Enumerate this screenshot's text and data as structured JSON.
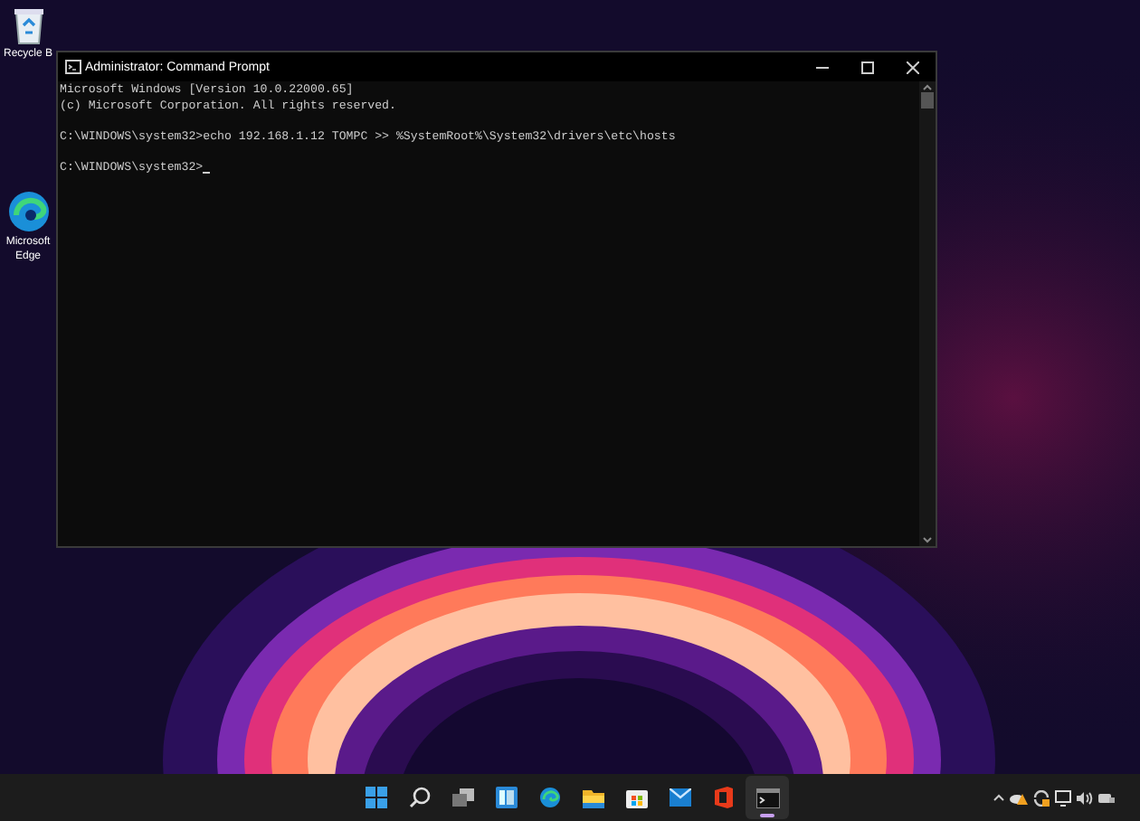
{
  "desktop_icons": [
    {
      "kind": "recycle",
      "label": "Recycle B"
    },
    {
      "kind": "edge",
      "label": "Microsoft Edge"
    }
  ],
  "window": {
    "title": "Administrator: Command Prompt"
  },
  "console": {
    "lines": [
      {
        "text": "Microsoft Windows [Version 10.0.22000.65]",
        "blank_before": false,
        "cursor": false
      },
      {
        "text": "(c) Microsoft Corporation. All rights reserved.",
        "blank_before": false,
        "cursor": false
      },
      {
        "text": "C:\\WINDOWS\\system32>echo 192.168.1.12 TOMPC >> %SystemRoot%\\System32\\drivers\\etc\\hosts",
        "blank_before": true,
        "cursor": false
      },
      {
        "text": "C:\\WINDOWS\\system32>",
        "blank_before": true,
        "cursor": true
      }
    ]
  },
  "taskbar": {
    "apps": [
      {
        "kind": "start",
        "selected": false
      },
      {
        "kind": "search",
        "selected": false
      },
      {
        "kind": "taskview",
        "selected": false
      },
      {
        "kind": "widgets",
        "selected": false
      },
      {
        "kind": "edge",
        "selected": false
      },
      {
        "kind": "explorer",
        "selected": false
      },
      {
        "kind": "store",
        "selected": false
      },
      {
        "kind": "mail",
        "selected": false
      },
      {
        "kind": "office",
        "selected": false
      },
      {
        "kind": "terminal",
        "selected": true
      }
    ],
    "tray": [
      {
        "kind": "chevron"
      },
      {
        "kind": "weather"
      },
      {
        "kind": "sync"
      },
      {
        "kind": "display"
      },
      {
        "kind": "speaker"
      },
      {
        "kind": "network"
      }
    ]
  }
}
